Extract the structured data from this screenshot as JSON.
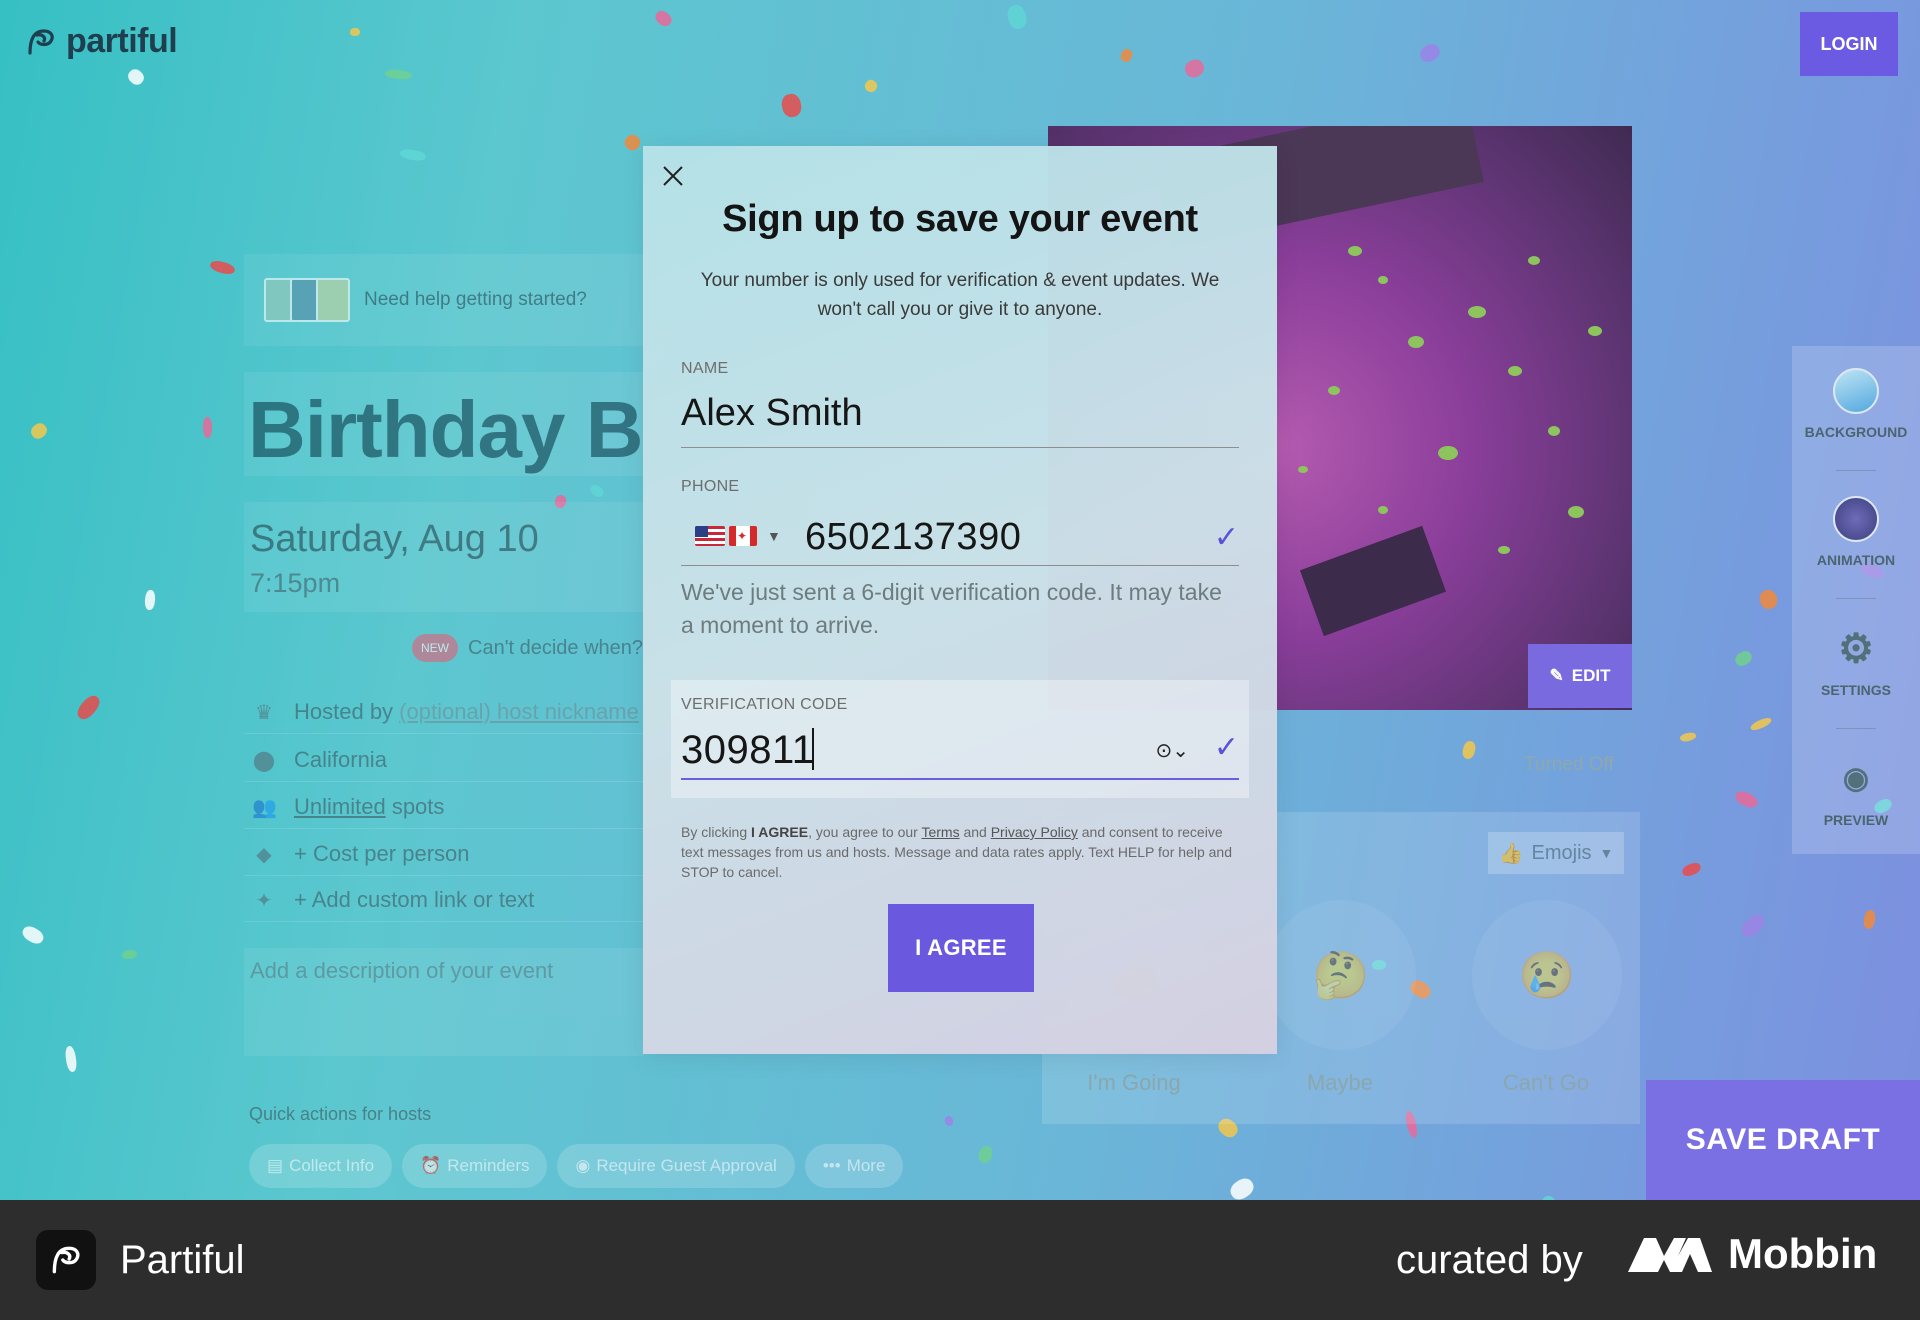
{
  "brand": {
    "name": "partiful"
  },
  "header": {
    "login_label": "LOGIN"
  },
  "editor": {
    "help_text": "Need help getting started?",
    "event_title": "Birthday B",
    "date": "Saturday, Aug 10",
    "time": "7:15pm",
    "new_badge": "NEW",
    "cant_decide": "Can't decide when?",
    "hosted_prefix": "Hosted by ",
    "hosted_link": "(optional) host nickname",
    "location": "California",
    "spots_link": "Unlimited",
    "spots_suffix": " spots",
    "cost": "+ Cost per person",
    "custom_link": "+ Add custom link or text",
    "description_placeholder": "Add a description of your event",
    "quick_actions_label": "Quick actions for hosts",
    "quick_actions": [
      {
        "icon": "form-icon",
        "label": "Collect Info"
      },
      {
        "icon": "bell-icon",
        "label": "Reminders"
      },
      {
        "icon": "approval-icon",
        "label": "Require Guest Approval"
      },
      {
        "icon": "dots-icon",
        "label": "More"
      }
    ],
    "edit_label": "EDIT",
    "turned_off": "Turned Off",
    "emojis_label": "Emojis",
    "rsvp": [
      {
        "emoji": "👍",
        "label": "I'm Going"
      },
      {
        "emoji": "🤔",
        "label": "Maybe"
      },
      {
        "emoji": "😢",
        "label": "Can't Go"
      }
    ],
    "save_draft": "SAVE DRAFT"
  },
  "side_rail": {
    "items": [
      {
        "label": "BACKGROUND",
        "icon": "background-swatch-icon"
      },
      {
        "label": "ANIMATION",
        "icon": "animation-swatch-icon"
      },
      {
        "label": "SETTINGS",
        "icon": "gear-icon"
      },
      {
        "label": "PREVIEW",
        "icon": "eye-icon"
      }
    ]
  },
  "modal": {
    "title": "Sign up to save your event",
    "subtitle": "Your number is only used for verification & event updates. We won't call you or give it to anyone.",
    "name_label": "NAME",
    "name_value": "Alex Smith",
    "phone_label": "PHONE",
    "phone_value": "6502137390",
    "verify_message": "We've just sent a 6-digit verification code. It may take a moment to arrive.",
    "code_label": "VERIFICATION CODE",
    "code_value": "309811",
    "legal_1": "By clicking ",
    "legal_agree": "I AGREE",
    "legal_2": ", you agree to our ",
    "legal_terms": "Terms",
    "legal_3": " and ",
    "legal_privacy": "Privacy Policy",
    "legal_4": " and consent to receive text messages from us and hosts. Message and data rates apply. Text HELP for help and STOP to cancel.",
    "agree_label": "I AGREE"
  },
  "footer": {
    "app_name": "Partiful",
    "curated_by": "curated by",
    "mobbin": "Mobbin"
  },
  "colors": {
    "accent": "#6a58df",
    "check": "#5b52d9",
    "footer_bg": "#2d2d2d"
  }
}
